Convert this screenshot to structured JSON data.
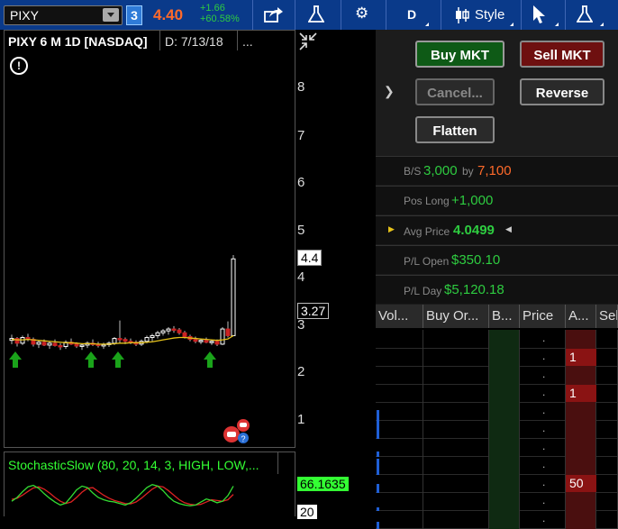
{
  "toolbar": {
    "symbol": "PIXY",
    "link_number": "3",
    "last_price": "4.40",
    "change_abs": "+1.66",
    "change_pct": "+60.58%",
    "aggregation": "D",
    "style_label": "Style",
    "icons": [
      "share-icon",
      "flask-icon",
      "gear-icon",
      "candlestick-icon",
      "cursor-icon",
      "flask-icon"
    ]
  },
  "chart": {
    "title": "PIXY 6 M 1D [NASDAQ]",
    "date": "D: 7/13/18",
    "dots": "...",
    "y_labels": [
      "8",
      "7",
      "6",
      "5",
      "4",
      "3",
      "2",
      "1"
    ],
    "price_box": "4.4",
    "marker_box": "3.27",
    "colors": {
      "bull": "#ffffff",
      "bear": "#cc2222",
      "ma": "#e6c21a",
      "arrow": "#1aa31a",
      "stoch_k": "#33dd33",
      "stoch_d": "#dd2222"
    }
  },
  "chart_data": {
    "type": "candlestick",
    "y_range": [
      0.5,
      8.6
    ],
    "candles": [
      [
        2.68,
        2.8,
        2.6,
        2.72
      ],
      [
        2.72,
        2.75,
        2.55,
        2.62
      ],
      [
        2.62,
        2.78,
        2.58,
        2.74
      ],
      [
        2.74,
        2.82,
        2.66,
        2.7
      ],
      [
        2.7,
        2.74,
        2.55,
        2.6
      ],
      [
        2.6,
        2.68,
        2.52,
        2.64
      ],
      [
        2.64,
        2.7,
        2.56,
        2.58
      ],
      [
        2.58,
        2.66,
        2.5,
        2.62
      ],
      [
        2.62,
        2.7,
        2.55,
        2.57
      ],
      [
        2.57,
        2.62,
        2.48,
        2.55
      ],
      [
        2.55,
        2.68,
        2.5,
        2.64
      ],
      [
        2.64,
        2.72,
        2.58,
        2.6
      ],
      [
        2.6,
        2.64,
        2.52,
        2.56
      ],
      [
        2.56,
        2.62,
        2.48,
        2.58
      ],
      [
        2.58,
        2.66,
        2.52,
        2.62
      ],
      [
        2.62,
        2.7,
        2.56,
        2.6
      ],
      [
        2.6,
        2.65,
        2.53,
        2.57
      ],
      [
        2.57,
        2.63,
        2.5,
        2.59
      ],
      [
        2.59,
        2.66,
        2.54,
        2.62
      ],
      [
        2.62,
        2.75,
        2.58,
        2.72
      ],
      [
        2.72,
        3.1,
        2.62,
        2.7
      ],
      [
        2.7,
        2.74,
        2.6,
        2.66
      ],
      [
        2.66,
        2.72,
        2.6,
        2.64
      ],
      [
        2.64,
        2.68,
        2.56,
        2.6
      ],
      [
        2.6,
        2.7,
        2.56,
        2.66
      ],
      [
        2.66,
        2.78,
        2.62,
        2.74
      ],
      [
        2.74,
        2.82,
        2.66,
        2.78
      ],
      [
        2.78,
        2.88,
        2.72,
        2.84
      ],
      [
        2.84,
        2.92,
        2.78,
        2.88
      ],
      [
        2.88,
        2.96,
        2.8,
        2.92
      ],
      [
        2.92,
        2.98,
        2.84,
        2.9
      ],
      [
        2.9,
        2.94,
        2.8,
        2.84
      ],
      [
        2.84,
        2.88,
        2.72,
        2.76
      ],
      [
        2.76,
        2.8,
        2.66,
        2.7
      ],
      [
        2.7,
        2.76,
        2.62,
        2.66
      ],
      [
        2.66,
        2.72,
        2.6,
        2.68
      ],
      [
        2.68,
        2.74,
        2.62,
        2.64
      ],
      [
        2.64,
        2.7,
        2.58,
        2.66
      ],
      [
        2.66,
        2.7,
        2.56,
        2.6
      ],
      [
        2.6,
        2.96,
        2.58,
        2.92
      ],
      [
        2.92,
        3.08,
        2.74,
        2.78
      ],
      [
        2.78,
        4.48,
        3.5,
        4.4
      ]
    ],
    "ma": [
      2.7,
      2.69,
      2.69,
      2.7,
      2.69,
      2.68,
      2.67,
      2.66,
      2.65,
      2.64,
      2.63,
      2.63,
      2.62,
      2.61,
      2.61,
      2.61,
      2.6,
      2.6,
      2.6,
      2.61,
      2.62,
      2.62,
      2.63,
      2.63,
      2.63,
      2.64,
      2.65,
      2.67,
      2.69,
      2.71,
      2.73,
      2.74,
      2.74,
      2.73,
      2.72,
      2.71,
      2.7,
      2.69,
      2.68,
      2.69,
      2.71,
      2.78
    ],
    "arrows": [
      0,
      14,
      19,
      36
    ],
    "stoch_k": [
      40,
      50,
      65,
      78,
      82,
      74,
      60,
      48,
      38,
      30,
      35,
      52,
      70,
      80,
      76,
      62,
      50,
      44,
      40,
      38,
      34,
      30,
      36,
      48,
      62,
      76,
      84,
      80,
      68,
      52,
      40,
      34,
      30,
      28,
      30,
      38,
      46,
      42,
      36,
      40,
      55,
      80
    ],
    "stoch_d": [
      45,
      48,
      56,
      66,
      75,
      78,
      72,
      62,
      50,
      40,
      34,
      38,
      50,
      64,
      74,
      76,
      66,
      56,
      48,
      42,
      38,
      34,
      33,
      38,
      48,
      60,
      72,
      80,
      78,
      68,
      56,
      44,
      36,
      32,
      30,
      32,
      38,
      44,
      42,
      40,
      44,
      58
    ],
    "stoch_range": [
      0,
      100
    ]
  },
  "stochastic": {
    "label": "StochasticSlow (80, 20, 14, 3, HIGH, LOW,...",
    "value_box": "66.1635",
    "low_box": "20"
  },
  "order_panel": {
    "buy_label": "Buy MKT",
    "sell_label": "Sell MKT",
    "cancel_label": "Cancel...",
    "reverse_label": "Reverse",
    "flatten_label": "Flatten"
  },
  "position": {
    "bs_label": "B/S",
    "bs_buy": "3,000",
    "bs_by": "by",
    "bs_sell": "7,100",
    "pos_label": "Pos Long",
    "pos_value": "+1,000",
    "avg_label": "Avg Price",
    "avg_value": "4.0499",
    "plopen_label": "P/L Open",
    "plopen_value": "$350.10",
    "plday_label": "P/L Day",
    "plday_value": "$5,120.18"
  },
  "ladder": {
    "headers": [
      "Vol...",
      "Buy Or...",
      "B...",
      "Price",
      "A...",
      "Sel"
    ],
    "rows": [
      {
        "price": ".",
        "ask": "",
        "bar": 0
      },
      {
        "price": ".",
        "ask": "1",
        "bar": 0
      },
      {
        "price": ".",
        "ask": "",
        "bar": 0
      },
      {
        "price": ".",
        "ask": "1",
        "bar": 0
      },
      {
        "price": ".",
        "ask": "",
        "bar": 12
      },
      {
        "price": ".",
        "ask": "",
        "bar": 20
      },
      {
        "price": ".",
        "ask": "",
        "bar": 6
      },
      {
        "price": ".",
        "ask": "",
        "bar": 18
      },
      {
        "price": ".",
        "ask": "50",
        "bar": 10
      },
      {
        "price": ".",
        "ask": "",
        "bar": 4
      },
      {
        "price": ".",
        "ask": "",
        "bar": 8
      }
    ]
  }
}
